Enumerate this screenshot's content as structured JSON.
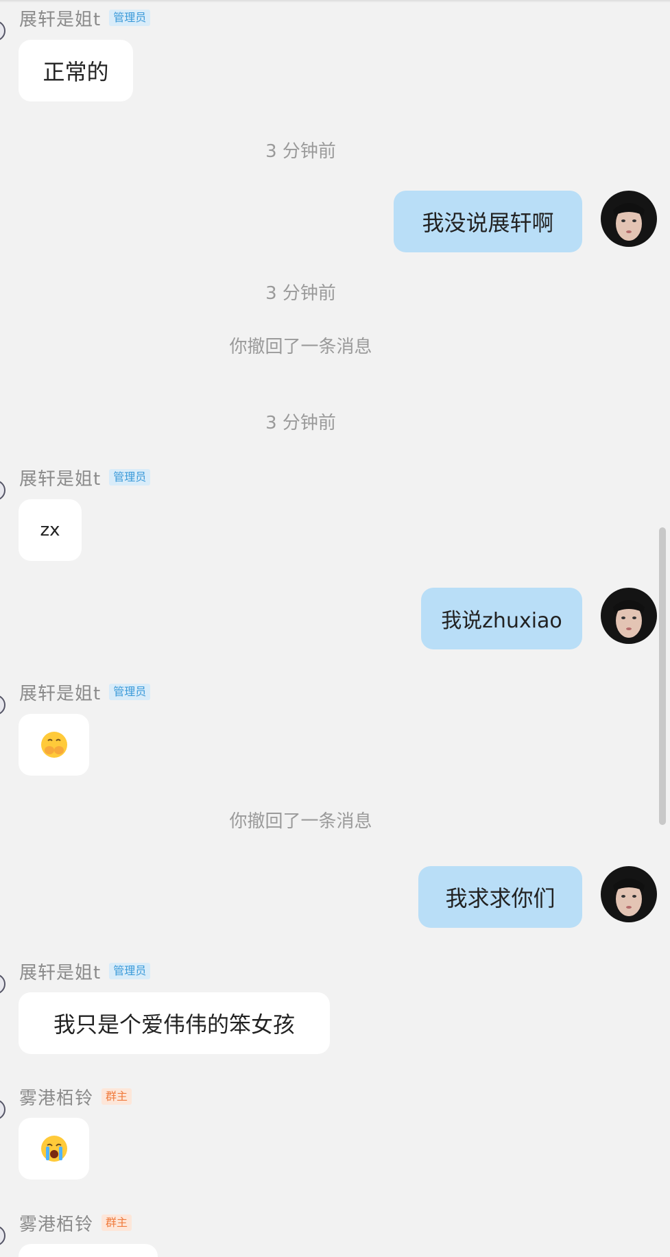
{
  "messages": [
    {
      "sender": "展轩是姐t",
      "badge": "管理员",
      "text": "正常的"
    },
    {
      "timestamp": "3 分钟前"
    },
    {
      "text": "我没说展轩啊",
      "from": "me"
    },
    {
      "timestamp": "3 分钟前"
    },
    {
      "system": "你撤回了一条消息"
    },
    {
      "timestamp": "3 分钟前"
    },
    {
      "sender": "展轩是姐t",
      "badge": "管理员",
      "text": "zx"
    },
    {
      "text": "我说zhuxiao",
      "from": "me"
    },
    {
      "sender": "展轩是姐t",
      "badge": "管理员",
      "emoji": "covering-mouth-emoji"
    },
    {
      "system": "你撤回了一条消息"
    },
    {
      "text": "我求求你们",
      "from": "me"
    },
    {
      "sender": "展轩是姐t",
      "badge": "管理员",
      "text": "我只是个爱伟伟的笨女孩"
    },
    {
      "sender": "雾港栢铃",
      "badge": "群主",
      "emoji": "crying-emoji"
    },
    {
      "sender": "雾港栢铃",
      "badge": "群主"
    }
  ],
  "colors": {
    "background": "#f2f2f2",
    "incoming_bubble": "#ffffff",
    "outgoing_bubble": "#b9def7",
    "admin_badge": "#3b9ad9",
    "owner_badge": "#f07a3c"
  }
}
